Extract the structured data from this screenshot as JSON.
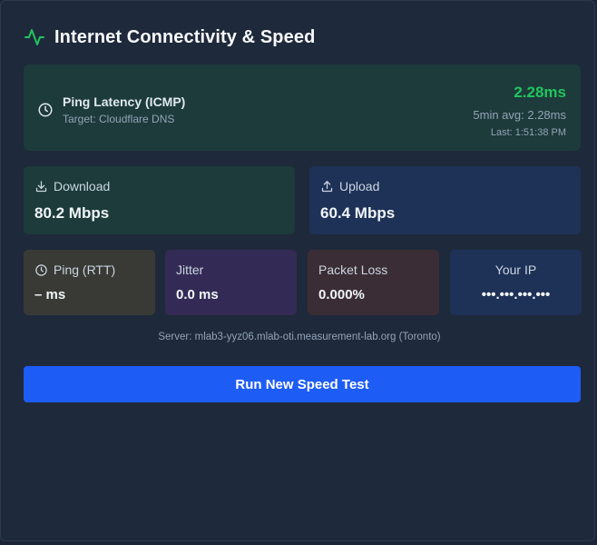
{
  "header": {
    "title": "Internet Connectivity & Speed",
    "icon": "activity-pulse-icon",
    "icon_color": "#22c55e"
  },
  "ping": {
    "label": "Ping Latency (ICMP)",
    "target": "Target: Cloudflare DNS",
    "value": "2.28ms",
    "avg": "5min avg: 2.28ms",
    "last": "Last: 1:51:38 PM",
    "icon": "clock-icon",
    "value_color": "#22c55e"
  },
  "download": {
    "label": "Download",
    "value": "80.2 Mbps",
    "icon": "download-icon"
  },
  "upload": {
    "label": "Upload",
    "value": "60.4 Mbps",
    "icon": "upload-icon"
  },
  "rtt": {
    "label": "Ping (RTT)",
    "value": "– ms",
    "icon": "clock-icon"
  },
  "jitter": {
    "label": "Jitter",
    "value": "0.0 ms"
  },
  "packet_loss": {
    "label": "Packet Loss",
    "value": "0.000%"
  },
  "ip": {
    "label": "Your IP",
    "value": "•••.•••.•••.•••"
  },
  "server": "Server: mlab3-yyz06.mlab-oti.measurement-lab.org (Toronto)",
  "run_button": {
    "label": "Run New Speed Test",
    "color": "#1d5cf5"
  }
}
